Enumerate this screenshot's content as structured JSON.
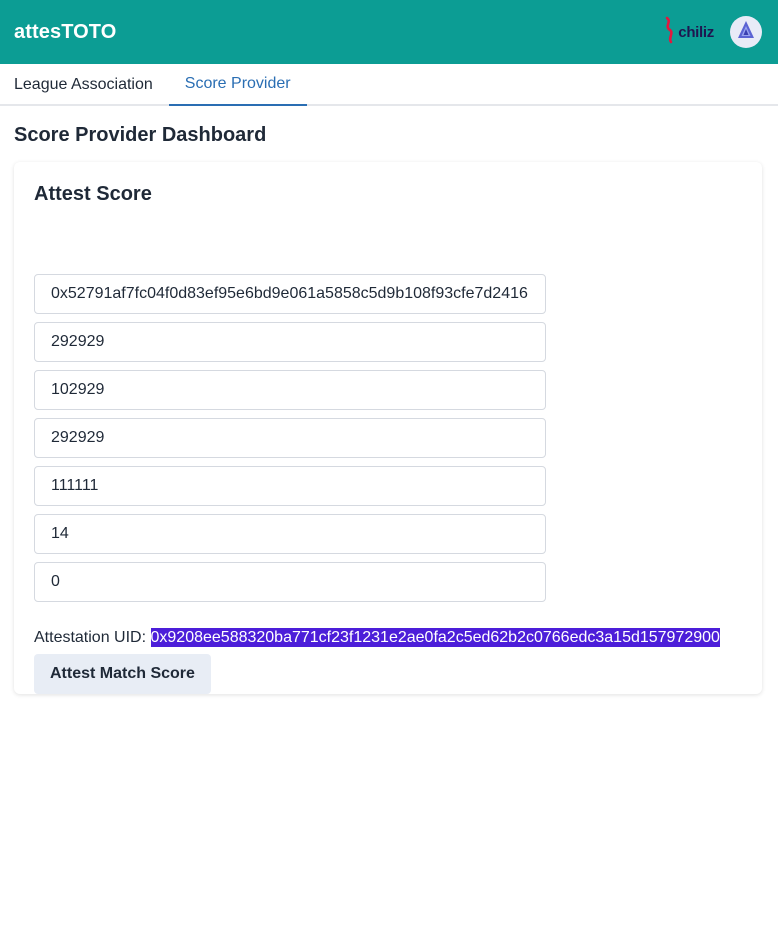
{
  "header": {
    "app_title": "attesTOTO",
    "partner_logo_text": "chiliz",
    "partner_logo_icon": "chiliz-flame-icon",
    "avatar_icon": "arbitrum-style-avatar-icon",
    "brand_color": "#0c9d94"
  },
  "tabs": [
    {
      "label": "League Association",
      "active": false
    },
    {
      "label": "Score Provider",
      "active": true
    }
  ],
  "page": {
    "title": "Score Provider Dashboard"
  },
  "card": {
    "title": "Attest Score",
    "fields": [
      {
        "value": "0x52791af7fc04f0d83ef95e6bd9e061a5858c5d9b108f93cfe7d2416"
      },
      {
        "value": "292929"
      },
      {
        "value": "102929"
      },
      {
        "value": "292929"
      },
      {
        "value": "111111"
      },
      {
        "value": "14"
      },
      {
        "value": "0"
      }
    ],
    "uid_label": "Attestation UID:",
    "uid_value": "0x9208ee588320ba771cf23f1231e2ae0fa2c5ed62b2c0766edc3a15d157972900",
    "submit_label": "Attest Match Score"
  }
}
